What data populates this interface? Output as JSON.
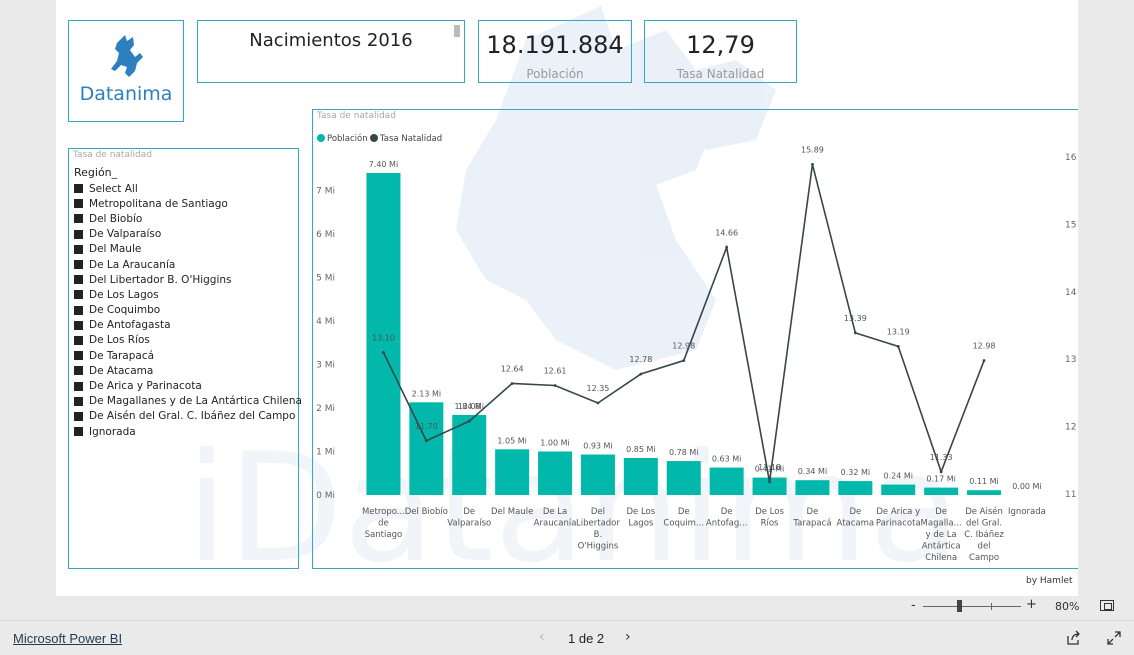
{
  "logo": {
    "text": "Datanima",
    "icon": "cat-icon"
  },
  "title": "Nacimientos 2016",
  "kpis": {
    "population": {
      "value": "18.191.884",
      "label": "Población"
    },
    "birth_rate": {
      "value": "12,79",
      "label": "Tasa Natalidad"
    }
  },
  "slicer": {
    "caption": "Tasa de natalidad",
    "header": "Región_",
    "items": [
      "Select All",
      "Metropolitana de Santiago",
      "Del Biobío",
      "De Valparaíso",
      "Del Maule",
      "De La Araucanía",
      "Del Libertador B. O'Higgins",
      "De Los Lagos",
      "De Coquimbo",
      "De Antofagasta",
      "De Los Ríos",
      "De Tarapacá",
      "De Atacama",
      "De Arica y Parinacota",
      "De Magallanes y de La Antártica Chilena",
      "De Aisén del Gral. C. Ibáñez del Campo",
      "Ignorada"
    ]
  },
  "chart_caption": "Tasa de natalidad",
  "chart_data": {
    "type": "bar",
    "legend": [
      "Población",
      "Tasa Natalidad"
    ],
    "legend_position": "top-left",
    "colors": {
      "bars": "#01b8aa",
      "line": "#374649"
    },
    "categories": [
      [
        "Metropo...",
        "de",
        "Santiago"
      ],
      [
        "Del Biobío"
      ],
      [
        "De",
        "Valparaíso"
      ],
      [
        "Del Maule"
      ],
      [
        "De La",
        "Araucanía"
      ],
      [
        "Del",
        "Libertador",
        "B.",
        "O'Higgins"
      ],
      [
        "De Los",
        "Lagos"
      ],
      [
        "De",
        "Coquim..."
      ],
      [
        "De",
        "Antofag..."
      ],
      [
        "De Los",
        "Ríos"
      ],
      [
        "De",
        "Tarapacá"
      ],
      [
        "De",
        "Atacama"
      ],
      [
        "De Arica y",
        "Parinacota"
      ],
      [
        "De",
        "Magalla...",
        "y de La",
        "Antártica",
        "Chilena"
      ],
      [
        "De Aisén",
        "del Gral.",
        "C. Ibáñez",
        "del",
        "Campo"
      ],
      [
        "Ignorada"
      ]
    ],
    "series": [
      {
        "name": "Población",
        "axis": "left",
        "values": [
          7.4,
          2.13,
          1.84,
          1.05,
          1.0,
          0.93,
          0.85,
          0.78,
          0.63,
          0.4,
          0.34,
          0.32,
          0.24,
          0.17,
          0.11,
          0.0
        ],
        "labels": [
          "7.40 Mi",
          "2.13 Mi",
          "1.84 Mi",
          "1.05 Mi",
          "1.00 Mi",
          "0.93 Mi",
          "0.85 Mi",
          "0.78 Mi",
          "0.63 Mi",
          "0.41 Mi",
          "0.34 Mi",
          "0.32 Mi",
          "0.24 Mi",
          "0.17 Mi",
          "0.11 Mi",
          "0.00 Mi"
        ]
      },
      {
        "name": "Tasa Natalidad",
        "axis": "right",
        "values": [
          13.1,
          11.79,
          12.08,
          12.64,
          12.61,
          12.35,
          12.78,
          12.98,
          14.66,
          11.18,
          15.89,
          13.39,
          13.19,
          11.33,
          12.98,
          null
        ],
        "labels": [
          "13.10",
          "11.70",
          "12.08",
          "12.64",
          "12.61",
          "12.35",
          "12.78",
          "12.98",
          "14.66",
          "11.18",
          "15.89",
          "13.39",
          "13.19",
          "11.33",
          "12.98",
          ""
        ]
      }
    ],
    "y_left": {
      "ticks": [
        0,
        1,
        2,
        3,
        4,
        5,
        6,
        7
      ],
      "tick_labels": [
        "0 Mi",
        "1 Mi",
        "2 Mi",
        "3 Mi",
        "4 Mi",
        "5 Mi",
        "6 Mi",
        "7 Mi"
      ],
      "ylim": [
        0,
        7.4
      ]
    },
    "y_right": {
      "ticks": [
        11,
        12,
        13,
        14,
        15,
        16
      ],
      "tick_labels": [
        "11",
        "12",
        "13",
        "14",
        "15",
        "16"
      ],
      "ylim": [
        11,
        16
      ]
    },
    "grid": false
  },
  "attribution": "by Hamlet",
  "zoom": {
    "minus": "-",
    "plus": "+",
    "level": "80%"
  },
  "footer": {
    "powerbi_link": "Microsoft Power BI",
    "page_indicator": "1 de 2",
    "prev": "‹",
    "next": "›"
  }
}
